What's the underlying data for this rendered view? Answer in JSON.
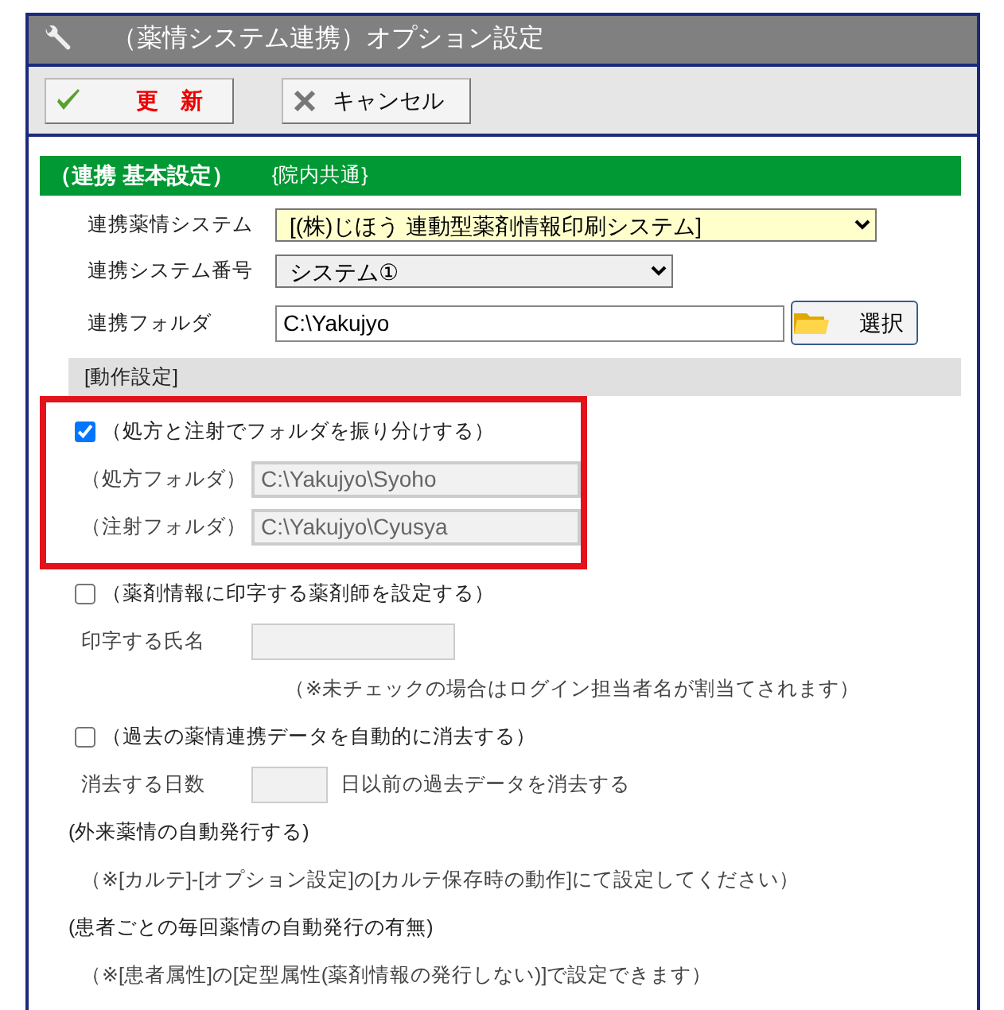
{
  "window": {
    "title": "（薬情システム連携）オプション設定"
  },
  "toolbar": [
    {
      "label": "更　新",
      "kind": "update"
    },
    {
      "label": "キャンセル",
      "kind": "cancel"
    }
  ],
  "section": {
    "title": "（連携 基本設定）",
    "note": "{院内共通}"
  },
  "settings": [
    {
      "label": "連携薬情システム",
      "kind": "select",
      "value": "[(株)じほう 連動型薬剤情報印刷システム]",
      "highlighted": true
    },
    {
      "label": "連携システム番号",
      "kind": "select",
      "value": "システム①",
      "highlighted": false
    },
    {
      "label": "連携フォルダ",
      "kind": "folder",
      "value": "C:\\Yakujyo",
      "button": "選択"
    }
  ],
  "behavior": {
    "title": "[動作設定]",
    "groups": [
      {
        "framed": true,
        "items": [
          {
            "kind": "checkbox",
            "label": "（処方と注射でフォルダを振り分けする）",
            "checked": true
          },
          {
            "kind": "wide-field",
            "label": "（処方フォルダ）",
            "value": "C:\\Yakujyo\\Syoho",
            "disabled": true
          },
          {
            "kind": "wide-field",
            "label": "（注射フォルダ）",
            "value": "C:\\Yakujyo\\Cyusya",
            "disabled": true
          }
        ]
      },
      {
        "framed": false,
        "items": [
          {
            "kind": "checkbox",
            "label": "（薬剤情報に印字する薬剤師を設定する）",
            "checked": false
          },
          {
            "kind": "short-field",
            "label": "印字する氏名",
            "disabled": true
          },
          {
            "kind": "centered-note",
            "text": "（※未チェックの場合はログイン担当者名が割当てされます）"
          },
          {
            "kind": "checkbox",
            "label": "（過去の薬情連携データを自動的に消去する）",
            "checked": false
          },
          {
            "kind": "number-field",
            "label": "消去する日数",
            "suffix": "日以前の過去データを消去する",
            "disabled": true
          },
          {
            "kind": "heading",
            "text": "(外来薬情の自動発行する)"
          },
          {
            "kind": "note",
            "text": "（※[カルテ]-[オプション設定]の[カルテ保存時の動作]にて設定してください）"
          },
          {
            "kind": "heading",
            "text": "(患者ごとの毎回薬情の自動発行の有無)"
          },
          {
            "kind": "note",
            "text": "（※[患者属性]の[定型属性(薬剤情報の発行しない)]で設定できます）"
          }
        ]
      }
    ]
  }
}
